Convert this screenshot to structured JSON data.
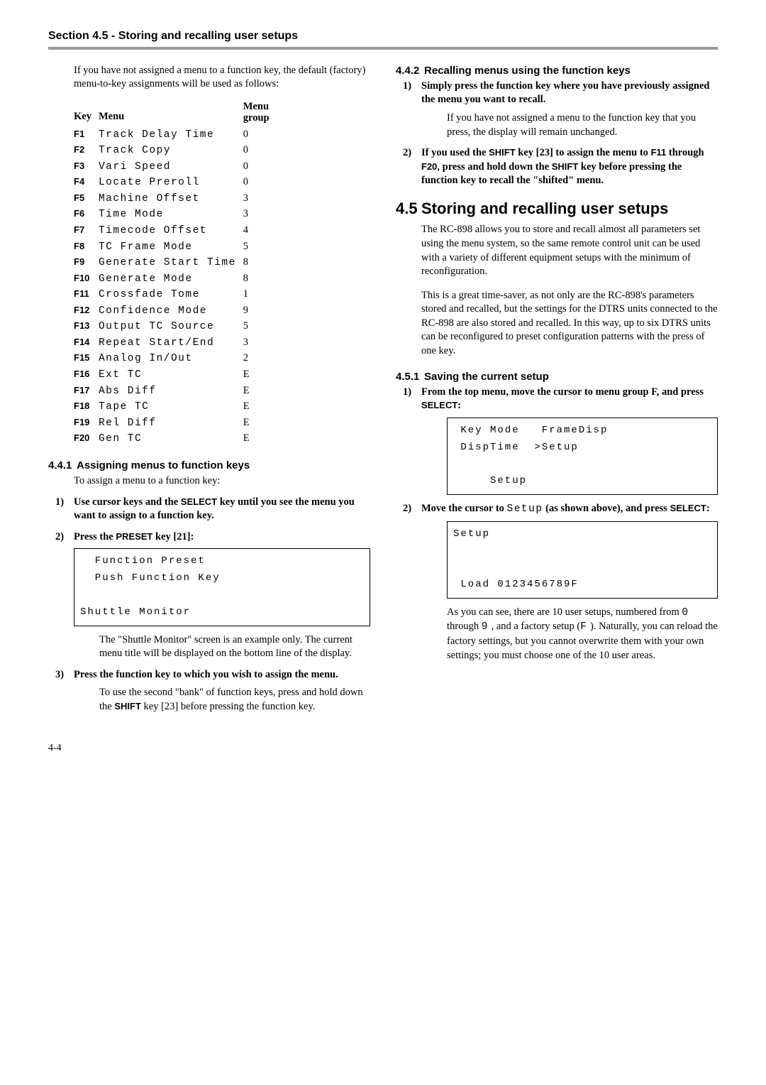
{
  "header": "Section 4.5 - Storing and recalling user setups",
  "left": {
    "intro": "If you have not assigned a menu to a function key, the default (factory) menu-to-key assignments will be used as follows:",
    "table": {
      "headers": {
        "key": "Key",
        "menu": "Menu",
        "group_l1": "Menu",
        "group_l2": "group"
      },
      "rows": [
        {
          "key": "F1",
          "menu": "Track Delay Time",
          "group": "0"
        },
        {
          "key": "F2",
          "menu": "Track Copy",
          "group": "0"
        },
        {
          "key": "F3",
          "menu": "Vari Speed",
          "group": "0"
        },
        {
          "key": "F4",
          "menu": "Locate Preroll",
          "group": "0"
        },
        {
          "key": "F5",
          "menu": "Machine Offset",
          "group": "3"
        },
        {
          "key": "F6",
          "menu": "Time Mode",
          "group": "3"
        },
        {
          "key": "F7",
          "menu": "Timecode Offset",
          "group": "4"
        },
        {
          "key": "F8",
          "menu": "TC Frame Mode",
          "group": "5"
        },
        {
          "key": "F9",
          "menu": "Generate Start Time",
          "group": "8"
        },
        {
          "key": "F10",
          "menu": "Generate Mode",
          "group": "8"
        },
        {
          "key": "F11",
          "menu": "Crossfade Tome",
          "group": "1"
        },
        {
          "key": "F12",
          "menu": "Confidence Mode",
          "group": "9"
        },
        {
          "key": "F13",
          "menu": "Output TC Source",
          "group": "5"
        },
        {
          "key": "F14",
          "menu": "Repeat Start/End",
          "group": "3"
        },
        {
          "key": "F15",
          "menu": "Analog In/Out",
          "group": "2"
        },
        {
          "key": "F16",
          "menu": "Ext TC",
          "group": "E"
        },
        {
          "key": "F17",
          "menu": "Abs Diff",
          "group": "E"
        },
        {
          "key": "F18",
          "menu": "Tape TC",
          "group": "E"
        },
        {
          "key": "F19",
          "menu": "Rel Diff",
          "group": "E"
        },
        {
          "key": "F20",
          "menu": "Gen TC",
          "group": "E"
        }
      ]
    },
    "s441": {
      "num": "4.4.1",
      "title": "Assigning menus to function keys",
      "intro": "To assign a menu to a function key:",
      "step1_a": "Use cursor keys and the ",
      "step1_key": "SELECT",
      "step1_b": " key until you see the menu you want to assign to a function key.",
      "step2_a": "Press the ",
      "step2_key": "PRESET",
      "step2_b": " key [21]:",
      "lcd": "  Function Preset\n  Push Function Key\n\nShuttle Monitor",
      "lcd_note": "The \"Shuttle Monitor\" screen is an example only. The current menu title will be displayed on the bottom line of the display.",
      "step3": "Press the function key to which you wish to assign the menu.",
      "step3_note_a": "To use the second \"bank\" of function keys, press and hold down the ",
      "step3_note_key": "SHIFT",
      "step3_note_b": " key [23] before pressing the function key."
    }
  },
  "right": {
    "s442": {
      "num": "4.4.2",
      "title": "Recalling menus using the function keys",
      "step1": "Simply press the function key where you have previously assigned the menu you want to recall.",
      "step1_note": "If you have not assigned a menu to the function key that you press, the display will remain unchanged.",
      "step2_a": "If you used the ",
      "step2_k1": "SHIFT",
      "step2_b": " key [23] to assign the menu to ",
      "step2_k2": "F11",
      "step2_c": " through ",
      "step2_k3": "F20,",
      "step2_d": " press and hold down the ",
      "step2_k4": "SHIFT",
      "step2_e": " key before pressing the function key to recall the \"shifted\" menu."
    },
    "s45": {
      "num": "4.5",
      "title": "Storing and recalling user setups",
      "p1": "The RC-898 allows you to store and recall almost all parameters set using the menu system, so the same remote control unit can be used with a variety of different equipment setups with the minimum of reconfiguration.",
      "p2": "This is a great time-saver, as not only are the RC-898's parameters stored and recalled, but the settings for the DTRS units connected to the RC-898 are also stored and recalled. In this way, up to six DTRS units can be reconfigured to preset configuration patterns with the press of one key."
    },
    "s451": {
      "num": "4.5.1",
      "title": "Saving the current setup",
      "step1_a": "From the top menu, move the cursor to menu group F, and press ",
      "step1_key": "SELECT",
      "step1_b": ":",
      "lcd1": " Key Mode   FrameDisp\n DispTime  >Setup\n\n     Setup",
      "step2_a": "Move the cursor to ",
      "step2_mono": "Setup",
      "step2_b": "  (as shown above), and press ",
      "step2_key": "SELECT",
      "step2_c": ":",
      "lcd2": "Setup\n\n\n Load 0123456789F",
      "note_a": "As you can see, there are 10 user setups, numbered from ",
      "note_m1": "0",
      "note_b": "  through ",
      "note_m2": "9",
      "note_c": " , and a factory setup (",
      "note_m3": "F",
      "note_d": " ). Naturally, you can reload the factory settings, but you cannot overwrite them with your own settings; you must choose one of the 10 user areas."
    }
  },
  "pagenum": "4-4"
}
